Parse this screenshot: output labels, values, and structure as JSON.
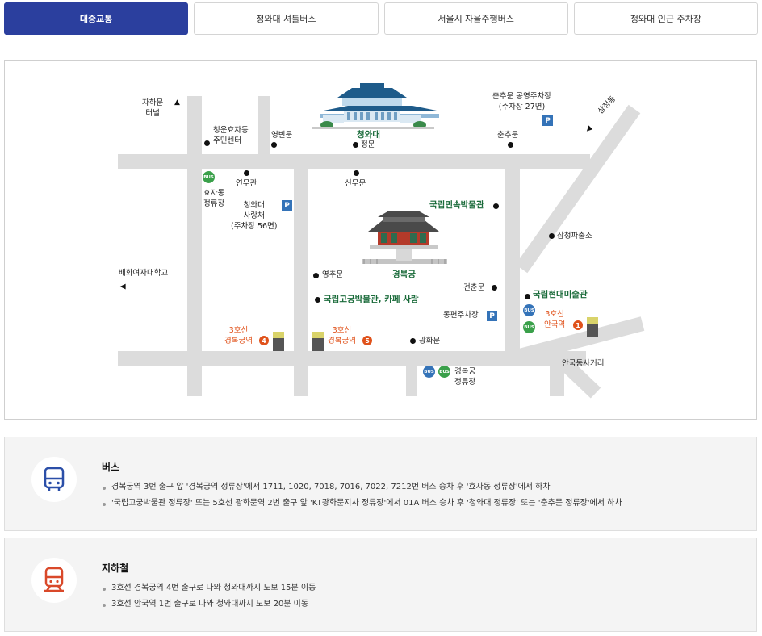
{
  "tabs": [
    {
      "label": "대중교통",
      "active": true
    },
    {
      "label": "청와대 셔틀버스",
      "active": false
    },
    {
      "label": "서울시 자율주행버스",
      "active": false
    },
    {
      "label": "청와대 인근 주차장",
      "active": false
    }
  ],
  "map": {
    "labels": {
      "jaha_tunnel": "자하문\n터널",
      "cheongun": "청운효자동\n주민센터",
      "yeongbin": "영빈문",
      "cheongwadae": "청와대",
      "jeongmun": "정문",
      "chunchu_parking": "춘추문 공영주차장\n(주차장 27면)",
      "samcheong_dong": "삼청동",
      "chunchu": "춘추문",
      "hyoja_bus": "효자동\n정류장",
      "yeonmu": "연무관",
      "sinmu": "신무문",
      "sarangchae": "청와대\n사랑채\n(주차장 56면)",
      "folk_museum": "국립민속박물관",
      "samcheong_police": "삼청파출소",
      "baehwa": "배화여자대학교",
      "gyeongbokgung": "경복궁",
      "yeongchu": "영추문",
      "geonchun": "건춘문",
      "palace_museum": "국립고궁박물관, 카페 사랑",
      "modern_art": "국립현대미술관",
      "dongpyeon_parking": "동편주차장",
      "line3_anguk": "3호선\n안국역",
      "line3_gyeongbok_4": "3호선\n경복궁역",
      "line3_gyeongbok_5": "3호선\n경복궁역",
      "gwanghwa": "광화문",
      "gyeongbok_bus": "경복궁\n정류장",
      "anguk_intersection": "안국동사거리",
      "exit4": "4",
      "exit5": "5",
      "exit1": "1",
      "parking_mark": "P",
      "bus_mark": "BUS"
    },
    "colors": {
      "road": "#dcdcdc",
      "green_label": "#1a6b3a",
      "orange_label": "#e0521b",
      "parking": "#3473b8",
      "bus_green": "#3aa04a",
      "bus_blue": "#3473b8"
    }
  },
  "bus": {
    "title": "버스",
    "icon": "bus-icon",
    "items": [
      "경복궁역 3번 출구 앞 '경복궁역 정류장'에서 1711, 1020, 7018, 7016, 7022, 7212번 버스 승차 후 '효자동 정류장'에서 하차",
      "'국립고궁박물관 정류장' 또는 5호선 광화문역 2번 출구 앞 'KT광화문지사 정류장'에서 01A 버스 승차 후 '청와대 정류장' 또는 '춘추문 정류장'에서 하차"
    ]
  },
  "subway": {
    "title": "지하철",
    "icon": "subway-icon",
    "items": [
      "3호선 경복궁역 4번 출구로 나와 청와대까지 도보 15분 이동",
      "3호선 안국역 1번 출구로 나와 청와대까지 도보 20분 이동"
    ]
  }
}
